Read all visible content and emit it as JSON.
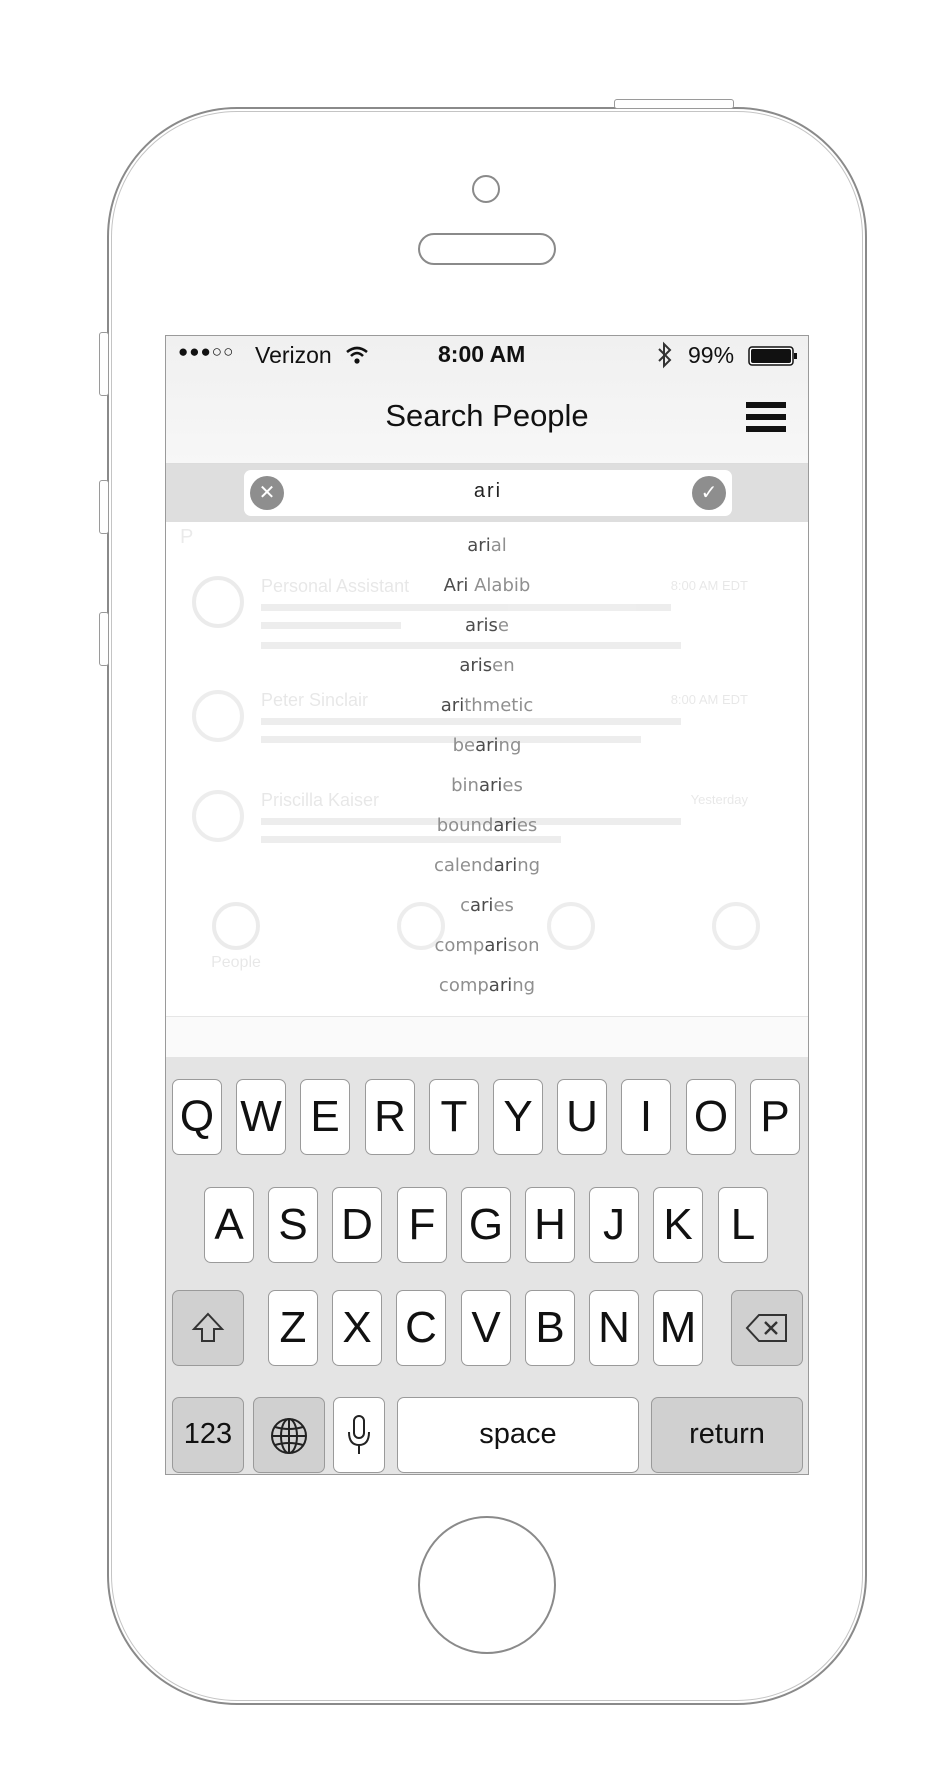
{
  "status_bar": {
    "signal": "●●●○○",
    "carrier": "Verizon",
    "time": "8:00 AM",
    "battery": "99%",
    "wifi_icon": "wifi-icon",
    "bluetooth_icon": "bluetooth-icon"
  },
  "nav": {
    "title": "Search People",
    "menu_icon": "hamburger-menu-icon"
  },
  "search": {
    "value": "ari",
    "clear_icon": "clear-icon",
    "confirm_icon": "checkmark-icon"
  },
  "suggestions": [
    {
      "pre": "",
      "match": "ari",
      "post": "al"
    },
    {
      "pre": "",
      "match": "Ari",
      "post": " Alabib"
    },
    {
      "pre": "",
      "match": "aris",
      "post": "e"
    },
    {
      "pre": "",
      "match": "aris",
      "post": "en"
    },
    {
      "pre": "",
      "match": "ari",
      "post": "thmetic"
    },
    {
      "pre": "be",
      "match": "ari",
      "post": "ng"
    },
    {
      "pre": "bin",
      "match": "ari",
      "post": "es"
    },
    {
      "pre": "bound",
      "match": "ari",
      "post": "es"
    },
    {
      "pre": "calend",
      "match": "ari",
      "post": "ng"
    },
    {
      "pre": "c",
      "match": "ari",
      "post": "es"
    },
    {
      "pre": "comp",
      "match": "ari",
      "post": "son"
    },
    {
      "pre": "comp",
      "match": "ari",
      "post": "ng"
    }
  ],
  "background": {
    "section_letter": "P",
    "rows": [
      {
        "name": "Personal Assistant",
        "time": "8:00 AM EDT"
      },
      {
        "name": "Peter Sinclair",
        "time": "8:00 AM EDT"
      },
      {
        "name": "Priscilla Kaiser",
        "time": "Yesterday"
      }
    ],
    "tab_people": "People"
  },
  "keyboard": {
    "row1": [
      "Q",
      "W",
      "E",
      "R",
      "T",
      "Y",
      "U",
      "I",
      "O",
      "P"
    ],
    "row2": [
      "A",
      "S",
      "D",
      "F",
      "G",
      "H",
      "J",
      "K",
      "L"
    ],
    "row3": [
      "Z",
      "X",
      "C",
      "V",
      "B",
      "N",
      "M"
    ],
    "numbers_key": "123",
    "space_key": "space",
    "return_key": "return",
    "shift_icon": "shift-icon",
    "delete_icon": "backspace-icon",
    "globe_icon": "globe-icon",
    "mic_icon": "microphone-icon"
  }
}
